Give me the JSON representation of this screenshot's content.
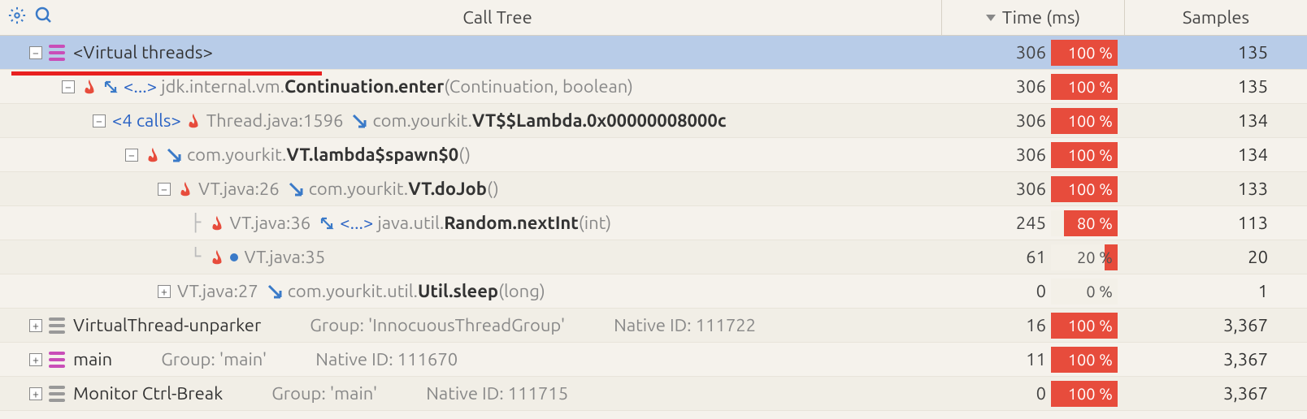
{
  "header": {
    "calltree": "Call Tree",
    "time": "Time (ms)",
    "samples": "Samples"
  },
  "rows": [
    {
      "time": "306",
      "pct": "100 %",
      "pctFill": 100,
      "pctWhite": true,
      "samples": "135",
      "main": "<Virtual threads>"
    },
    {
      "time": "306",
      "pct": "100 %",
      "pctFill": 100,
      "pctWhite": true,
      "samples": "135",
      "ellipsis": "<...>",
      "pkg": "jdk.internal.vm.",
      "method": "Continuation.enter",
      "args": "(Continuation, boolean)"
    },
    {
      "time": "306",
      "pct": "100 %",
      "pctFill": 100,
      "pctWhite": true,
      "samples": "134",
      "calls": "<4 calls>",
      "loc": "Thread.java:1596",
      "pkg": "com.yourkit.",
      "method": "VT$$Lambda.0x00000008000c"
    },
    {
      "time": "306",
      "pct": "100 %",
      "pctFill": 100,
      "pctWhite": true,
      "samples": "134",
      "pkg": "com.yourkit.",
      "method": "VT.lambda$spawn$0",
      "args": "()"
    },
    {
      "time": "306",
      "pct": "100 %",
      "pctFill": 100,
      "pctWhite": true,
      "samples": "133",
      "loc": "VT.java:26",
      "pkg": "com.yourkit.",
      "method": "VT.doJob",
      "args": "()"
    },
    {
      "time": "245",
      "pct": "80 %",
      "pctFill": 80,
      "pctWhite": true,
      "samples": "113",
      "loc": "VT.java:36",
      "ellipsis": "<...>",
      "pkg": "java.util.",
      "method": "Random.nextInt",
      "args": "(int)"
    },
    {
      "time": "61",
      "pct": "20 %",
      "pctFill": 20,
      "pctWhite": false,
      "samples": "20",
      "loc": "VT.java:35"
    },
    {
      "time": "0",
      "pct": "0 %",
      "pctFill": 0,
      "pctWhite": false,
      "samples": "1",
      "loc": "VT.java:27",
      "pkg": "com.yourkit.util.",
      "method": "Util.sleep",
      "args": "(long)"
    },
    {
      "time": "16",
      "pct": "100 %",
      "pctFill": 100,
      "pctWhite": true,
      "samples": "3,367",
      "thread": "VirtualThread-unparker",
      "group": "Group: 'InnocuousThreadGroup'",
      "native": "Native ID: 111722"
    },
    {
      "time": "11",
      "pct": "100 %",
      "pctFill": 100,
      "pctWhite": true,
      "samples": "3,367",
      "thread": "main",
      "group": "Group: 'main'",
      "native": "Native ID: 111670"
    },
    {
      "time": "0",
      "pct": "100 %",
      "pctFill": 100,
      "pctWhite": true,
      "samples": "3,367",
      "thread": "Monitor Ctrl-Break",
      "group": "Group: 'main'",
      "native": "Native ID: 111715"
    }
  ]
}
